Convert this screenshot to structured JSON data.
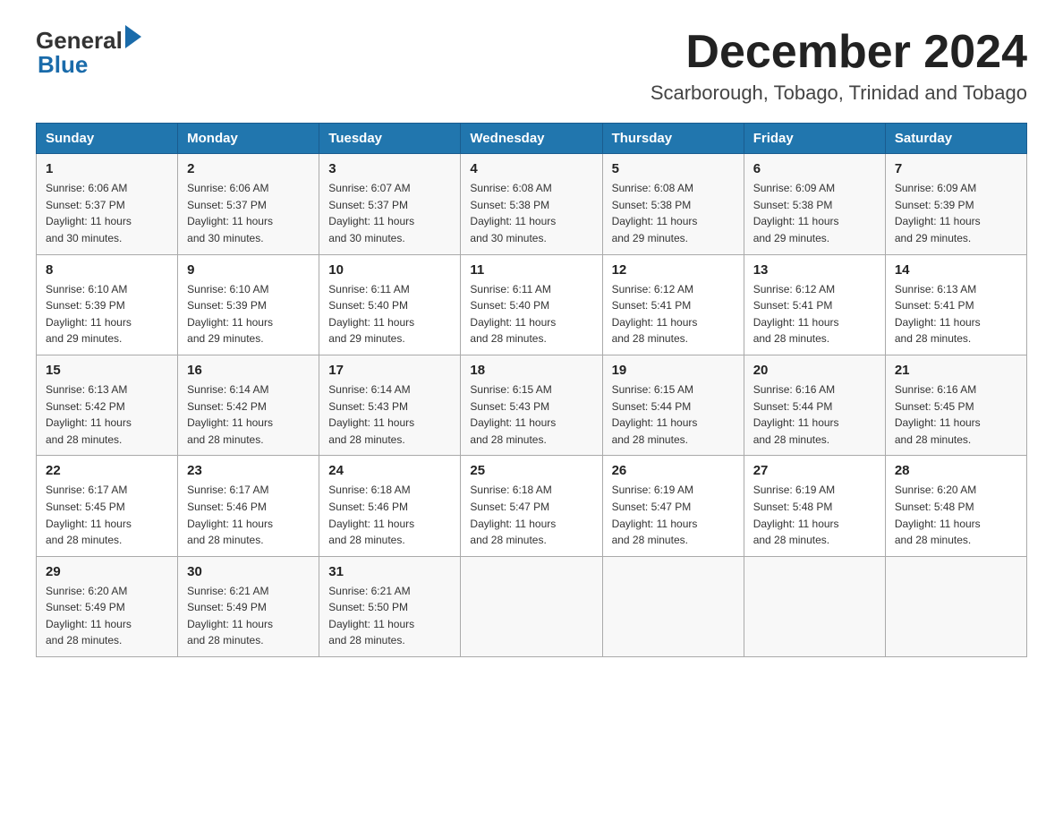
{
  "header": {
    "logo_general": "General",
    "logo_blue": "Blue",
    "month_title": "December 2024",
    "location": "Scarborough, Tobago, Trinidad and Tobago"
  },
  "days_of_week": [
    "Sunday",
    "Monday",
    "Tuesday",
    "Wednesday",
    "Thursday",
    "Friday",
    "Saturday"
  ],
  "weeks": [
    [
      {
        "day": "1",
        "sunrise": "6:06 AM",
        "sunset": "5:37 PM",
        "daylight": "11 hours and 30 minutes."
      },
      {
        "day": "2",
        "sunrise": "6:06 AM",
        "sunset": "5:37 PM",
        "daylight": "11 hours and 30 minutes."
      },
      {
        "day": "3",
        "sunrise": "6:07 AM",
        "sunset": "5:37 PM",
        "daylight": "11 hours and 30 minutes."
      },
      {
        "day": "4",
        "sunrise": "6:08 AM",
        "sunset": "5:38 PM",
        "daylight": "11 hours and 30 minutes."
      },
      {
        "day": "5",
        "sunrise": "6:08 AM",
        "sunset": "5:38 PM",
        "daylight": "11 hours and 29 minutes."
      },
      {
        "day": "6",
        "sunrise": "6:09 AM",
        "sunset": "5:38 PM",
        "daylight": "11 hours and 29 minutes."
      },
      {
        "day": "7",
        "sunrise": "6:09 AM",
        "sunset": "5:39 PM",
        "daylight": "11 hours and 29 minutes."
      }
    ],
    [
      {
        "day": "8",
        "sunrise": "6:10 AM",
        "sunset": "5:39 PM",
        "daylight": "11 hours and 29 minutes."
      },
      {
        "day": "9",
        "sunrise": "6:10 AM",
        "sunset": "5:39 PM",
        "daylight": "11 hours and 29 minutes."
      },
      {
        "day": "10",
        "sunrise": "6:11 AM",
        "sunset": "5:40 PM",
        "daylight": "11 hours and 29 minutes."
      },
      {
        "day": "11",
        "sunrise": "6:11 AM",
        "sunset": "5:40 PM",
        "daylight": "11 hours and 28 minutes."
      },
      {
        "day": "12",
        "sunrise": "6:12 AM",
        "sunset": "5:41 PM",
        "daylight": "11 hours and 28 minutes."
      },
      {
        "day": "13",
        "sunrise": "6:12 AM",
        "sunset": "5:41 PM",
        "daylight": "11 hours and 28 minutes."
      },
      {
        "day": "14",
        "sunrise": "6:13 AM",
        "sunset": "5:41 PM",
        "daylight": "11 hours and 28 minutes."
      }
    ],
    [
      {
        "day": "15",
        "sunrise": "6:13 AM",
        "sunset": "5:42 PM",
        "daylight": "11 hours and 28 minutes."
      },
      {
        "day": "16",
        "sunrise": "6:14 AM",
        "sunset": "5:42 PM",
        "daylight": "11 hours and 28 minutes."
      },
      {
        "day": "17",
        "sunrise": "6:14 AM",
        "sunset": "5:43 PM",
        "daylight": "11 hours and 28 minutes."
      },
      {
        "day": "18",
        "sunrise": "6:15 AM",
        "sunset": "5:43 PM",
        "daylight": "11 hours and 28 minutes."
      },
      {
        "day": "19",
        "sunrise": "6:15 AM",
        "sunset": "5:44 PM",
        "daylight": "11 hours and 28 minutes."
      },
      {
        "day": "20",
        "sunrise": "6:16 AM",
        "sunset": "5:44 PM",
        "daylight": "11 hours and 28 minutes."
      },
      {
        "day": "21",
        "sunrise": "6:16 AM",
        "sunset": "5:45 PM",
        "daylight": "11 hours and 28 minutes."
      }
    ],
    [
      {
        "day": "22",
        "sunrise": "6:17 AM",
        "sunset": "5:45 PM",
        "daylight": "11 hours and 28 minutes."
      },
      {
        "day": "23",
        "sunrise": "6:17 AM",
        "sunset": "5:46 PM",
        "daylight": "11 hours and 28 minutes."
      },
      {
        "day": "24",
        "sunrise": "6:18 AM",
        "sunset": "5:46 PM",
        "daylight": "11 hours and 28 minutes."
      },
      {
        "day": "25",
        "sunrise": "6:18 AM",
        "sunset": "5:47 PM",
        "daylight": "11 hours and 28 minutes."
      },
      {
        "day": "26",
        "sunrise": "6:19 AM",
        "sunset": "5:47 PM",
        "daylight": "11 hours and 28 minutes."
      },
      {
        "day": "27",
        "sunrise": "6:19 AM",
        "sunset": "5:48 PM",
        "daylight": "11 hours and 28 minutes."
      },
      {
        "day": "28",
        "sunrise": "6:20 AM",
        "sunset": "5:48 PM",
        "daylight": "11 hours and 28 minutes."
      }
    ],
    [
      {
        "day": "29",
        "sunrise": "6:20 AM",
        "sunset": "5:49 PM",
        "daylight": "11 hours and 28 minutes."
      },
      {
        "day": "30",
        "sunrise": "6:21 AM",
        "sunset": "5:49 PM",
        "daylight": "11 hours and 28 minutes."
      },
      {
        "day": "31",
        "sunrise": "6:21 AM",
        "sunset": "5:50 PM",
        "daylight": "11 hours and 28 minutes."
      },
      null,
      null,
      null,
      null
    ]
  ],
  "labels": {
    "sunrise_prefix": "Sunrise: ",
    "sunset_prefix": "Sunset: ",
    "daylight_prefix": "Daylight: "
  }
}
